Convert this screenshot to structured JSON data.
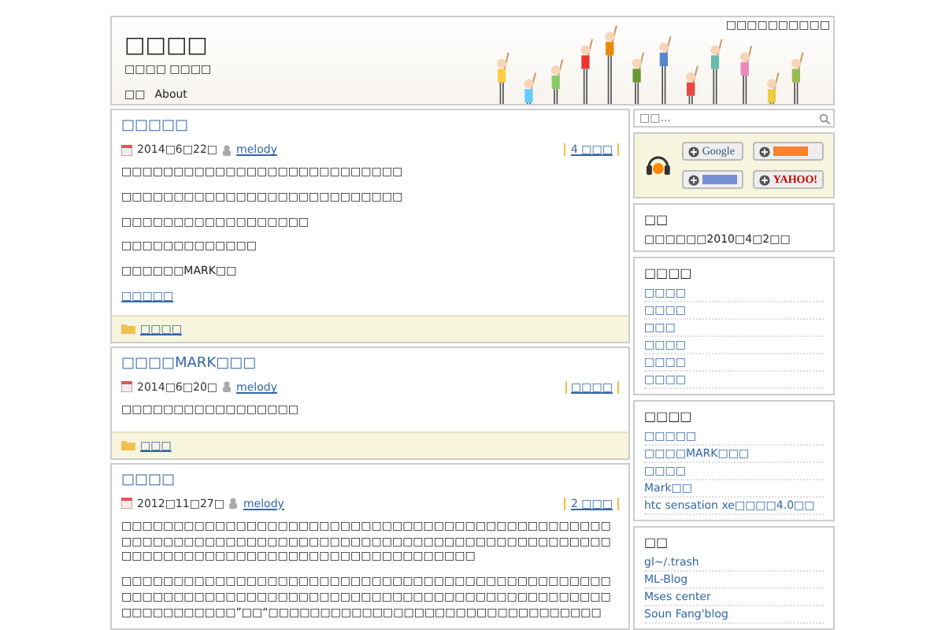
{
  "header": {
    "title": "□□□□",
    "tagline": "□□□□ □□□□",
    "top_link": "□□□□□□□□□□",
    "nav": [
      "□□",
      "About"
    ]
  },
  "posts": [
    {
      "title": "□□□□□",
      "date": "2014□6□22□",
      "author": "melody",
      "comments": "4 □□□",
      "paragraphs": [
        "□□□□□□□□□□□□□□□□□□□□□□□□□□□",
        "□□□□□□□□□□□□□□□□□□□□□□□□□□□",
        "□□□□□□□□□□□□□□□□□□",
        "□□□□□□□□□□□□□",
        "□□□□□□MARK□□"
      ],
      "more": "□□□□□",
      "category": "□□□□"
    },
    {
      "title": "□□□□MARK□□□",
      "date": "2014□6□20□",
      "author": "melody",
      "comments": "□□□□",
      "paragraphs": [
        "□□□□□□□□□□□□□□□□□"
      ],
      "category": "□□□"
    },
    {
      "title": "□□□□",
      "date": "2012□11□27□",
      "author": "melody",
      "comments": "2 □□□",
      "paragraphs": [
        "□□□□□□□□□□□□□□□□□□□□□□□□□□□□□□□□□□□□□□□□□□□□□□□□□□□□□□□□□□□□□□□□□□□□□□□□□□□□□□□□□□□□□□□□□□□□□□□□□□□□□□□□□□□□□□□□□□□□□□□□□□□□□□□□",
        "□□□□□□□□□□□□□□□□□□□□□□□□□□□□□□□□□□□□□□□□□□□□□□□□□□□□□□□□□□□□□□□□□□□□□□□□□□□□□□□□□□□□□□□□□□□□□□□□□□□□□□□□□”□□“□□□□□□□□□□□□□□□□□□□□□□□□□□□□□□□□"
      ]
    }
  ],
  "sidebar": {
    "search": {
      "placeholder": "□□..."
    },
    "subscribe": [
      {
        "kind": "google",
        "label": "Google"
      },
      {
        "kind": "reader"
      },
      {
        "kind": "myyahoo"
      },
      {
        "kind": "yahoo",
        "label": "YAHOO!"
      }
    ],
    "widgets": [
      {
        "kind": "text",
        "title": "□□",
        "text": "□□□□□□2010□4□2□□"
      },
      {
        "kind": "links",
        "title": "□□□□",
        "items": [
          "□□□□",
          "□□□□",
          "□□□",
          "□□□□",
          "□□□□",
          "□□□□"
        ]
      },
      {
        "kind": "links",
        "title": "□□□□",
        "items": [
          "□□□□□",
          "□□□□MARK□□□",
          "□□□□",
          "Mark□□",
          "htc sensation xe□□□□4.0□□"
        ]
      },
      {
        "kind": "links",
        "title": "□□",
        "items": [
          "gl~/.trash",
          "ML-Blog",
          "Mses center",
          "Soun Fang'blog"
        ]
      }
    ]
  }
}
